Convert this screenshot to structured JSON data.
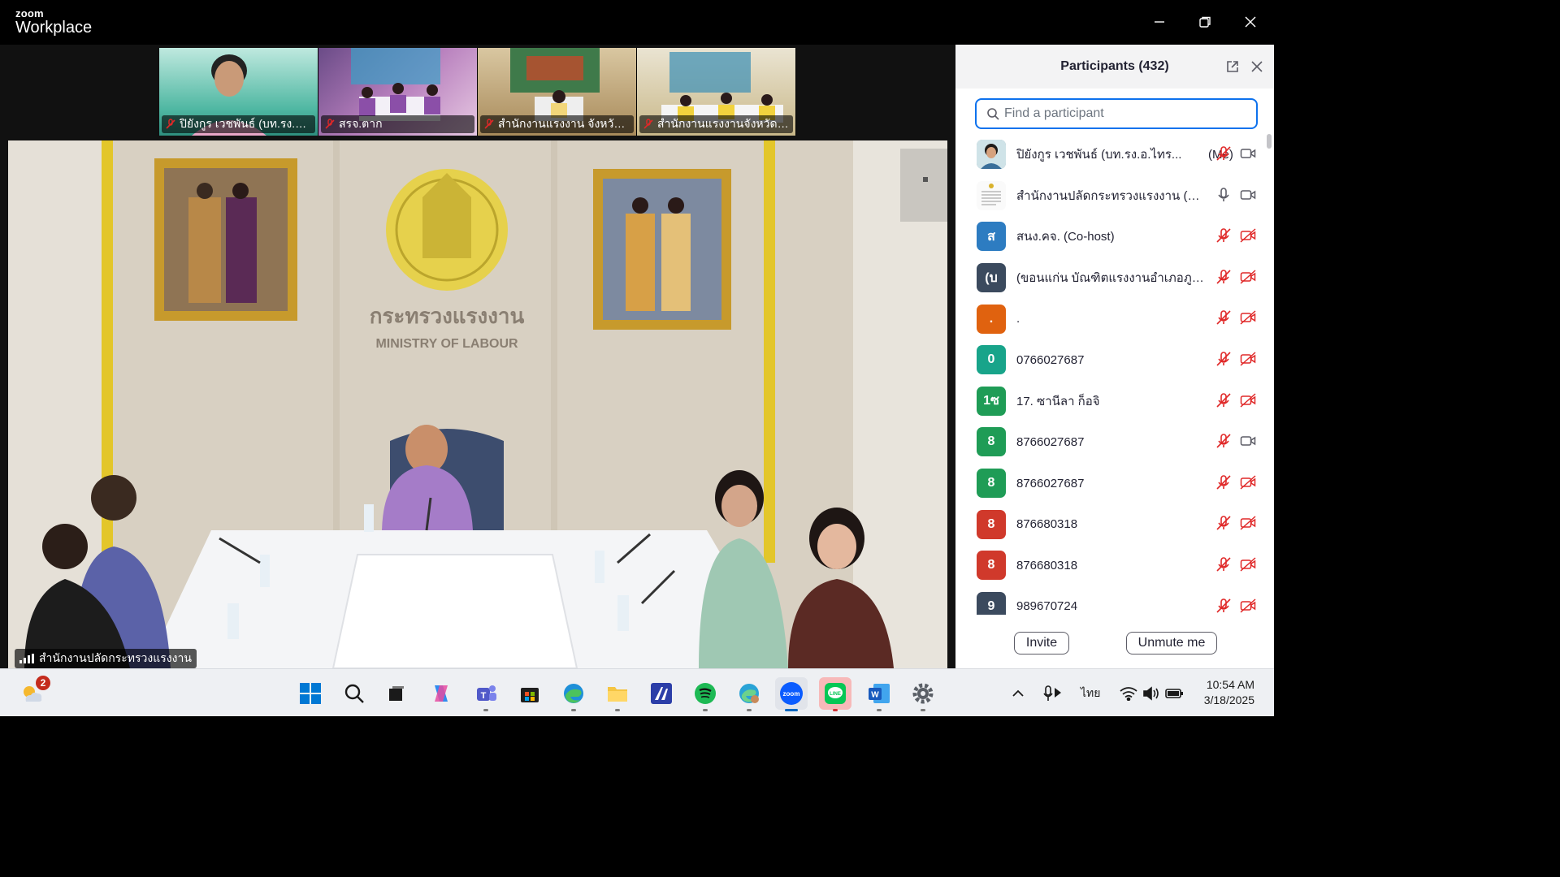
{
  "app": {
    "brand_small": "zoom",
    "brand_large": "Workplace"
  },
  "thumbnails": [
    {
      "name": "ปิยังกูร เวชพันธ์ (บท.รง.อ.ไ...",
      "muted": true,
      "bg": "#2fb19a"
    },
    {
      "name": "สรจ.ตาก",
      "muted": true,
      "bg": "#8a5ca8"
    },
    {
      "name": "สำนักงานแรงงาน จังหวัดก...",
      "muted": true,
      "bg": "#b89a6e"
    },
    {
      "name": "สำนักงานแรงงานจังหวัดนค...",
      "muted": true,
      "bg": "#c8b48a"
    }
  ],
  "main_video": {
    "label": "สำนักงานปลัดกระทรวงแรงงาน",
    "wall_text_th": "กระทรวงแรงงาน",
    "wall_text_en": "MINISTRY OF LABOUR"
  },
  "panel": {
    "title": "Participants (432)",
    "search_placeholder": "Find a participant",
    "invite_label": "Invite",
    "unmute_label": "Unmute me"
  },
  "participants": [
    {
      "initial": "",
      "avatar": "photo",
      "color": "#9ab",
      "name": "ปิยังกูร เวชพันธ์ (บท.รง.อ.ไทร...",
      "role": "(Me)",
      "mic": "muted",
      "video": "on"
    },
    {
      "initial": "",
      "avatar": "logo",
      "color": "#f4f4f4",
      "name": "สำนักงานปลัดกระทรวงแรงงาน (Host)",
      "role": "",
      "mic": "on",
      "video": "on"
    },
    {
      "initial": "ส",
      "avatar": "letter",
      "color": "#2d7cc1",
      "name": "สนง.คจ. (Co-host)",
      "role": "",
      "mic": "muted",
      "video": "off"
    },
    {
      "initial": "(บ",
      "avatar": "letter",
      "color": "#3b4a5e",
      "name": "(ขอนแก่น บัณฑิตแรงงานอำเภอภูเวีย...",
      "role": "",
      "mic": "muted",
      "video": "off"
    },
    {
      "initial": ".",
      "avatar": "letter",
      "color": "#e0620f",
      "name": ".",
      "role": "",
      "mic": "muted",
      "video": "off"
    },
    {
      "initial": "0",
      "avatar": "letter",
      "color": "#18a48a",
      "name": "0766027687",
      "role": "",
      "mic": "muted",
      "video": "off"
    },
    {
      "initial": "1ซ",
      "avatar": "letter",
      "color": "#1f9c56",
      "name": "17. ซานีลา ก็อจิ",
      "role": "",
      "mic": "muted",
      "video": "off"
    },
    {
      "initial": "8",
      "avatar": "letter",
      "color": "#1f9c56",
      "name": "8766027687",
      "role": "",
      "mic": "muted",
      "video": "on"
    },
    {
      "initial": "8",
      "avatar": "letter",
      "color": "#1f9c56",
      "name": "8766027687",
      "role": "",
      "mic": "muted",
      "video": "off"
    },
    {
      "initial": "8",
      "avatar": "letter",
      "color": "#d0392b",
      "name": "876680318",
      "role": "",
      "mic": "muted",
      "video": "off"
    },
    {
      "initial": "8",
      "avatar": "letter",
      "color": "#d0392b",
      "name": "876680318",
      "role": "",
      "mic": "muted",
      "video": "off"
    },
    {
      "initial": "9",
      "avatar": "letter",
      "color": "#3b4a5e",
      "name": "989670724",
      "role": "",
      "mic": "muted",
      "video": "off"
    }
  ],
  "taskbar": {
    "weather_badge": "2",
    "language": "ไทย",
    "time": "10:54 AM",
    "date": "3/18/2025"
  }
}
